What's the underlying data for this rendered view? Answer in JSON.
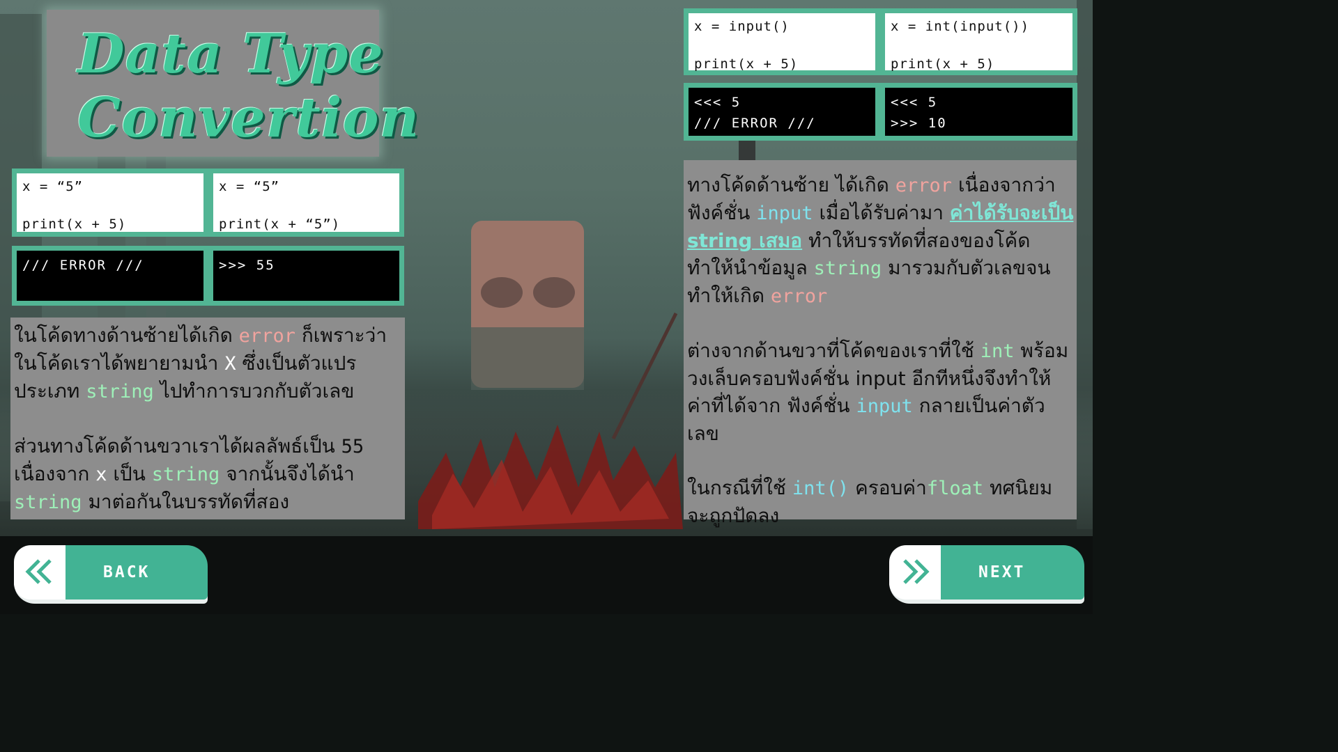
{
  "title": {
    "line1": "Data Type",
    "line2": "Convertion"
  },
  "left": {
    "code_cards": [
      {
        "line1": "x = “5”",
        "line2": "print(x + 5)"
      },
      {
        "line1": "x = “5”",
        "line2": "print(x + “5”)"
      }
    ],
    "output_cards": [
      {
        "line1": "/// ERROR ///",
        "line2": ""
      },
      {
        "line1": ">>> 55",
        "line2": ""
      }
    ],
    "explanation": {
      "p1_a": "ในโค้ดทางด้านซ้ายได้เกิด ",
      "p1_error": "error",
      "p1_b": " ก็เพราะว่าในโค้ดเราได้พยายามนำ ",
      "p1_x": "X",
      "p1_c": "  ซึ่งเป็นตัวแปรประเภท ",
      "p1_string": "string",
      "p1_d": " ไปทำการบวกกับตัวเลข",
      "p2_a": "ส่วนทางโค้ดด้านขวาเราได้ผลลัพธ์เป็น ",
      "p2_num": "55",
      "p2_b": " เนื่องจาก ",
      "p2_x": "x",
      "p2_c": " เป็น ",
      "p2_string": "string",
      "p2_d": " จากนั้นจึงได้นำ ",
      "p2_string2": "string",
      "p2_e": " มาต่อกันในบรรทัดที่สอง"
    }
  },
  "right": {
    "code_cards": [
      {
        "line1": "x = input()",
        "line2": "print(x + 5)"
      },
      {
        "line1": "x = int(input())",
        "line2": "print(x + 5)"
      }
    ],
    "output_cards": [
      {
        "line1": "<<< 5",
        "line2": "/// ERROR ///"
      },
      {
        "line1": "<<< 5",
        "line2": ">>> 10"
      }
    ],
    "explanation": {
      "p1_a": "ทางโค้ดด้านซ้าย ได้เกิด ",
      "p1_error": "error",
      "p1_b": " เนื่องจากว่าฟังค์ชั่น ",
      "p1_input": "input",
      "p1_c": " เมื่อได้รับค่ามา ",
      "p1_hl": "ค่าได้รับจะเป็น string เสมอ",
      "p1_d": " ทำให้บรรทัดที่สองของโค้ดทำให้นำข้อมูล ",
      "p1_string": "string",
      "p1_e": " มารวมกับตัวเลขจนทำให้เกิด ",
      "p1_error2": "error",
      "p2_a": "ต่างจากด้านขวาที่โค้ดของเราที่ใช้ ",
      "p2_int": "int",
      "p2_b": " พร้อมวงเล็บครอบฟังค์ชั่น input อีกทีหนึ่งจึงทำให้ค่าที่ได้จาก ฟังค์ชั่น ",
      "p2_input": "input",
      "p2_c": " กลายเป็นค่าตัวเลข",
      "p3_a": "ในกรณีที่ใช้ ",
      "p3_int": "int()",
      "p3_b": " ครอบค่า",
      "p3_float": "float",
      "p3_c": " ทศนิยมจะถูกปัดลง"
    }
  },
  "nav": {
    "back_label": "BACK",
    "next_label": "NEXT",
    "back_icon": "double-chevron-left-icon",
    "next_icon": "double-chevron-right-icon"
  },
  "colors": {
    "accent": "#52b594",
    "button": "#42b394",
    "keyword_red": "#f0a39e",
    "keyword_green": "#9ef0b8",
    "keyword_blue": "#7fe2ee"
  }
}
